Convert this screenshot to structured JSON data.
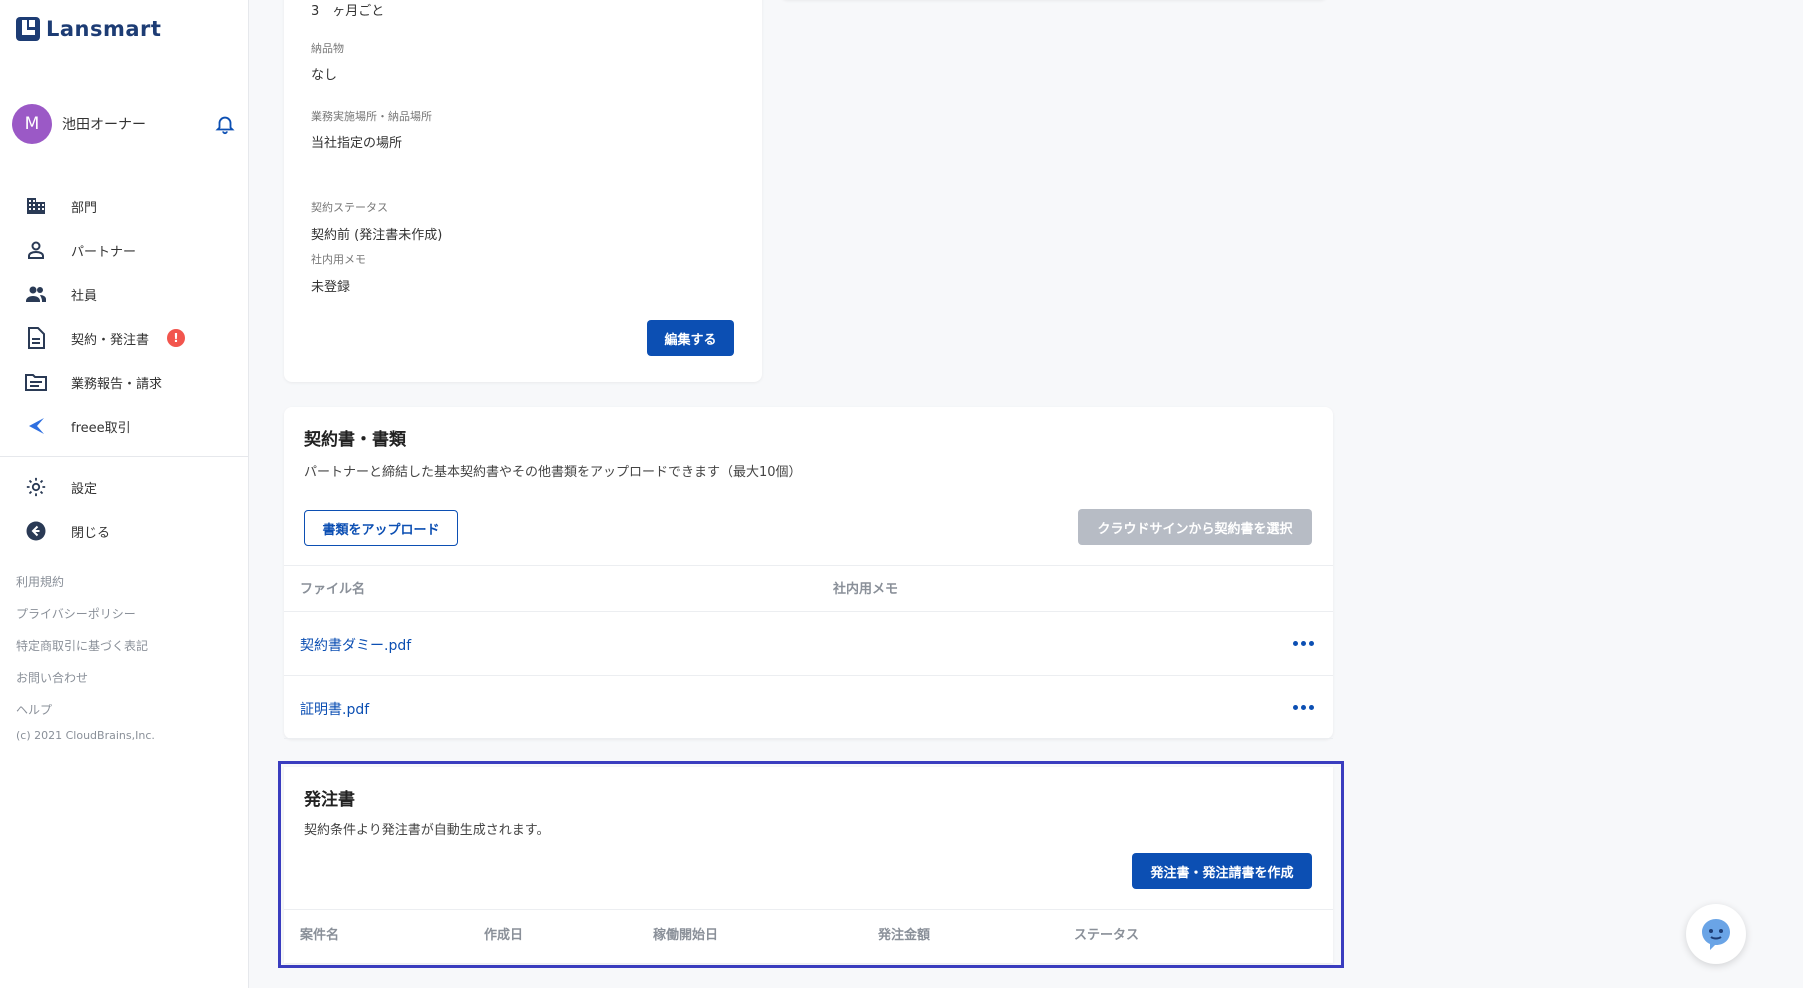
{
  "app": {
    "logo_text": "Lansmart"
  },
  "user": {
    "avatar_initial": "M",
    "name": "池田オーナー"
  },
  "nav": {
    "items": [
      {
        "label": "部門",
        "icon": "building-icon"
      },
      {
        "label": "パートナー",
        "icon": "person-icon"
      },
      {
        "label": "社員",
        "icon": "people-icon"
      },
      {
        "label": "契約・発注書",
        "icon": "document-icon",
        "badge": "!"
      },
      {
        "label": "業務報告・請求",
        "icon": "folder-icon"
      },
      {
        "label": "freee取引",
        "icon": "freee-icon"
      }
    ],
    "settings": "設定",
    "close": "閉じる"
  },
  "footer": {
    "links": [
      "利用規約",
      "プライバシーポリシー",
      "特定商取引に基づく表記",
      "お問い合わせ",
      "ヘルプ"
    ],
    "copyright": "(c) 2021 CloudBrains,Inc."
  },
  "contract": {
    "interval_value": "3　ヶ月ごと",
    "deliverable_label": "納品物",
    "deliverable_value": "なし",
    "location_label": "業務実施場所・納品場所",
    "location_value": "当社指定の場所",
    "status_label": "契約ステータス",
    "status_value": "契約前 (発注書未作成)",
    "memo_label": "社内用メモ",
    "memo_value": "未登録",
    "edit_button": "編集する"
  },
  "documents": {
    "title": "契約書・書類",
    "description": "パートナーと締結した基本契約書やその他書類をアップロードできます（最大10個）",
    "upload_button": "書類をアップロード",
    "cloudsign_button": "クラウドサインから契約書を選択",
    "columns": [
      "ファイル名",
      "社内用メモ"
    ],
    "files": [
      "契約書ダミー.pdf",
      "証明書.pdf"
    ]
  },
  "purchase_order": {
    "title": "発注書",
    "description": "契約条件より発注書が自動生成されます。",
    "create_button": "発注書・発注請書を作成",
    "columns": [
      "案件名",
      "作成日",
      "稼働開始日",
      "発注金額",
      "ステータス"
    ]
  },
  "colors": {
    "primary": "#0c4fb3",
    "badge": "#f2554d",
    "avatar": "#9b59c6",
    "highlight_frame": "#3a3dbf"
  }
}
